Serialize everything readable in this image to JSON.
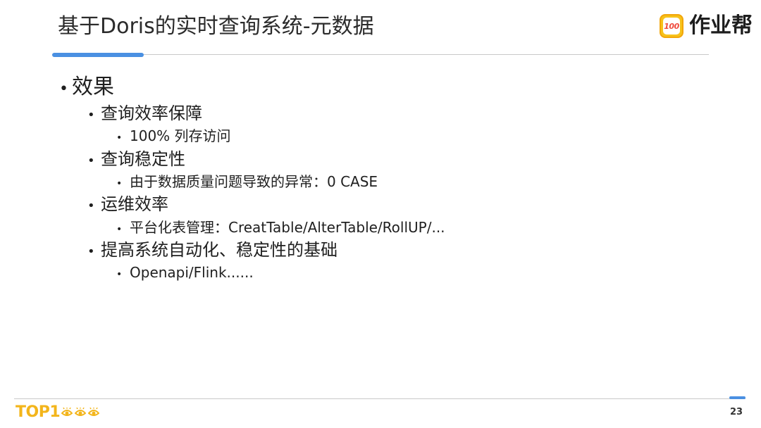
{
  "slide": {
    "title": "基于Doris的实时查询系统-元数据",
    "page_number": "23"
  },
  "brand": {
    "badge_text": "100",
    "name": "作业帮"
  },
  "footer": {
    "logo_text": "TOP1"
  },
  "bullets": {
    "level1": {
      "bullet": "•",
      "text": "效果"
    },
    "items": [
      {
        "bullet": "•",
        "text": "查询效率保障",
        "sub": {
          "bullet": "•",
          "text": "100% 列存访问"
        }
      },
      {
        "bullet": "•",
        "text": "查询稳定性",
        "sub": {
          "bullet": "•",
          "text": "由于数据质量问题导致的异常：0 CASE"
        }
      },
      {
        "bullet": "•",
        "text": "运维效率",
        "sub": {
          "bullet": "•",
          "text": "平台化表管理：CreatTable/AlterTable/RollUP/..."
        }
      },
      {
        "bullet": "•",
        "text": "提高系统自动化、稳定性的基础",
        "sub": {
          "bullet": "•",
          "text": "Openapi/Flink......"
        }
      }
    ]
  },
  "colors": {
    "accent_blue": "#4a90e2",
    "logo_yellow": "#f3b51b",
    "badge_red": "#ef4a3c"
  }
}
